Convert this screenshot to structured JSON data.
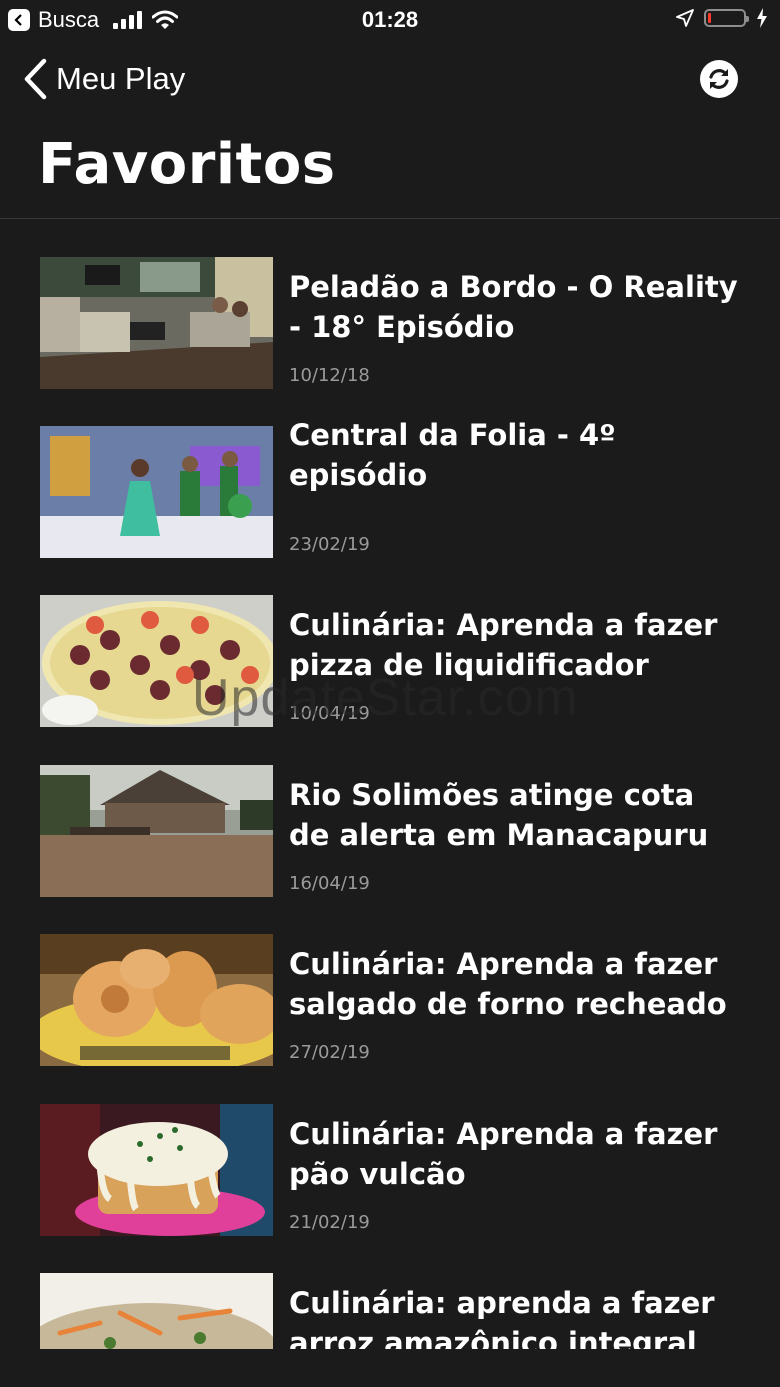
{
  "status_bar": {
    "back_app": "Busca",
    "time": "01:28",
    "battery_level": 0.08,
    "icons": [
      "back-app-icon",
      "signal-icon",
      "wifi-icon",
      "location-icon",
      "battery-icon",
      "charging-icon"
    ]
  },
  "nav": {
    "back_label": "Meu Play",
    "refresh_icon": "refresh-icon"
  },
  "page_title": "Favoritos",
  "watermark": "UpdateStar.com",
  "items": [
    {
      "title": "Peladão a Bordo - O Reality - 18° Episódio",
      "date": "10/12/18"
    },
    {
      "title": "Central da Folia - 4º episódio",
      "date": "23/02/19"
    },
    {
      "title": "Culinária: Aprenda a fazer pizza de liquidificador",
      "date": "10/04/19"
    },
    {
      "title": "Rio Solimões atinge cota de alerta em Manacapuru",
      "date": "16/04/19"
    },
    {
      "title": "Culinária: Aprenda a fazer salgado de forno recheado",
      "date": "27/02/19"
    },
    {
      "title": "Culinária: Aprenda a fazer pão vulcão",
      "date": "21/02/19"
    },
    {
      "title": "Culinária: aprenda a fazer arroz amazônico integral",
      "date": ""
    }
  ],
  "colors": {
    "background": "#1b1b1c",
    "text": "#ffffff",
    "date": "#9a9a9a",
    "divider": "#3a3a3c",
    "battery_low": "#ff3b30"
  }
}
